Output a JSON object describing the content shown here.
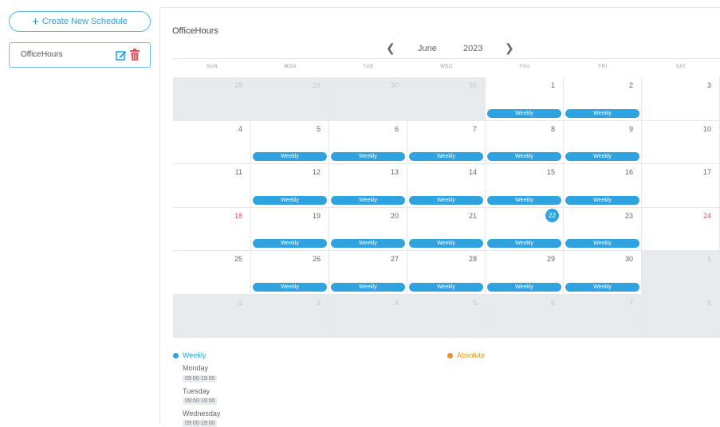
{
  "sidebar": {
    "create_label": "Create New Schedule",
    "schedules": [
      {
        "name": "OfficeHours"
      }
    ]
  },
  "main": {
    "title": "OfficeHours",
    "month": "June",
    "year": "2023",
    "weekdays": [
      "SUN",
      "MON",
      "TUE",
      "WED",
      "THU",
      "FRI",
      "SAT"
    ],
    "weeks": [
      [
        {
          "day": "28",
          "other": true
        },
        {
          "day": "29",
          "other": true
        },
        {
          "day": "30",
          "other": true
        },
        {
          "day": "31",
          "other": true
        },
        {
          "day": "1",
          "event": "Weekly"
        },
        {
          "day": "2",
          "event": "Weekly"
        },
        {
          "day": "3"
        }
      ],
      [
        {
          "day": "4"
        },
        {
          "day": "5",
          "event": "Weekly"
        },
        {
          "day": "6",
          "event": "Weekly"
        },
        {
          "day": "7",
          "event": "Weekly"
        },
        {
          "day": "8",
          "event": "Weekly"
        },
        {
          "day": "9",
          "event": "Weekly"
        },
        {
          "day": "10"
        }
      ],
      [
        {
          "day": "11"
        },
        {
          "day": "12",
          "event": "Weekly"
        },
        {
          "day": "13",
          "event": "Weekly"
        },
        {
          "day": "14",
          "event": "Weekly"
        },
        {
          "day": "15",
          "event": "Weekly"
        },
        {
          "day": "16",
          "event": "Weekly"
        },
        {
          "day": "17"
        }
      ],
      [
        {
          "day": "18",
          "red": true
        },
        {
          "day": "19",
          "event": "Weekly"
        },
        {
          "day": "20",
          "event": "Weekly"
        },
        {
          "day": "21",
          "event": "Weekly"
        },
        {
          "day": "22",
          "today": true,
          "event": "Weekly"
        },
        {
          "day": "23",
          "event": "Weekly"
        },
        {
          "day": "24",
          "red": true
        }
      ],
      [
        {
          "day": "25"
        },
        {
          "day": "26",
          "event": "Weekly"
        },
        {
          "day": "27",
          "event": "Weekly"
        },
        {
          "day": "28",
          "event": "Weekly"
        },
        {
          "day": "29",
          "event": "Weekly"
        },
        {
          "day": "30",
          "event": "Weekly"
        },
        {
          "day": "1",
          "other": true
        }
      ],
      [
        {
          "day": "2",
          "other": true
        },
        {
          "day": "3",
          "other": true
        },
        {
          "day": "4",
          "other": true
        },
        {
          "day": "5",
          "other": true
        },
        {
          "day": "6",
          "other": true
        },
        {
          "day": "7",
          "other": true
        },
        {
          "day": "8",
          "other": true
        }
      ]
    ]
  },
  "legend": {
    "weekly_label": "Weekly",
    "absolute_label": "Absolute",
    "weekly_color": "#2fa3e0",
    "absolute_color": "#e8922e",
    "days": [
      {
        "name": "Monday",
        "time": "09:00-19:00"
      },
      {
        "name": "Tuesday",
        "time": "09:00-19:00"
      },
      {
        "name": "Wednesday",
        "time": "09:00-19:00"
      }
    ]
  }
}
